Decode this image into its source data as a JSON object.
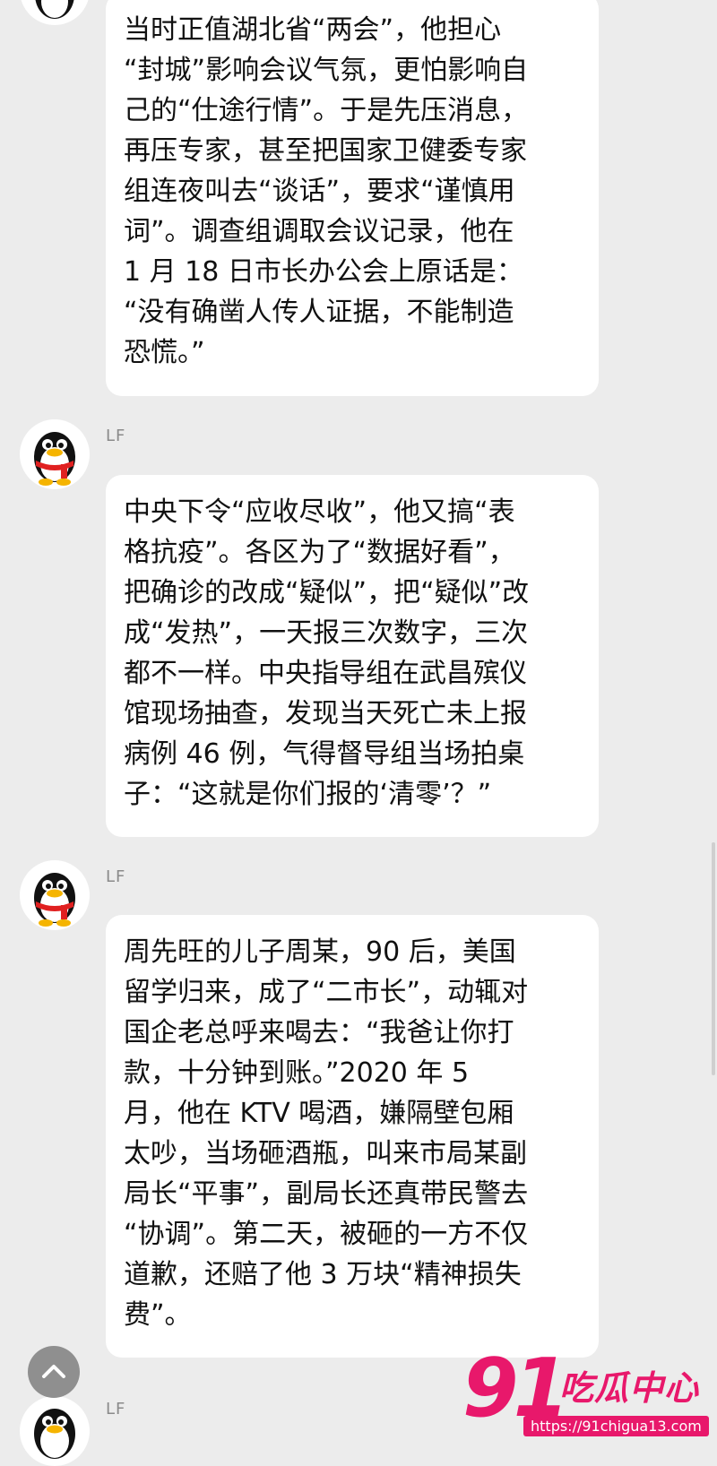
{
  "messages": [
    {
      "sender": "",
      "text": "当时正值湖北省“两会”，他担心\n“封城”影响会议气氛，更怕影响自\n己的“仕途行情”。于是先压消息，\n再压专家，甚至把国家卫健委专家\n组连夜叫去“谈话”，要求“谨慎用\n词”。调查组调取会议记录，他在\n1 月 18 日市长办公会上原话是：\n“没有确凿人传人证据，不能制造\n恐慌。”"
    },
    {
      "sender": "LF",
      "text": "中央下令“应收尽收”，他又搞“表\n格抗疫”。各区为了“数据好看”，\n把确诊的改成“疑似”，把“疑似”改\n成“发热”，一天报三次数字，三次\n都不一样。中央指导组在武昌殡仪\n馆现场抽查，发现当天死亡未上报\n病例 46 例，气得督导组当场拍桌\n子：“这就是你们报的‘清零’？”"
    },
    {
      "sender": "LF",
      "text": "周先旺的儿子周某，90 后，美国\n留学归来，成了“二市长”，动辄对\n国企老总呼来喝去：“我爸让你打\n款，十分钟到账。”2020 年 5\n月，他在 KTV 喝酒，嫌隔壁包厢\n太吵，当场砸酒瓶，叫来市局某副\n局长“平事”，副局长还真带民警去\n“协调”。第二天，被砸的一方不仅\n道歉，还赔了他 3 万块“精神损失\n费”。"
    },
    {
      "sender": "LF",
      "text": ""
    }
  ],
  "watermark": {
    "number": "91",
    "name": "吃瓜中心",
    "url": "https://91chigua13.com"
  },
  "icons": {
    "avatar": "qq-penguin-icon",
    "scroll_up": "chevron-up-icon"
  },
  "colors": {
    "background": "#ececec",
    "bubble": "#ffffff",
    "text": "#111111",
    "sender": "#8a8a8a",
    "watermark": "#e8186b"
  }
}
